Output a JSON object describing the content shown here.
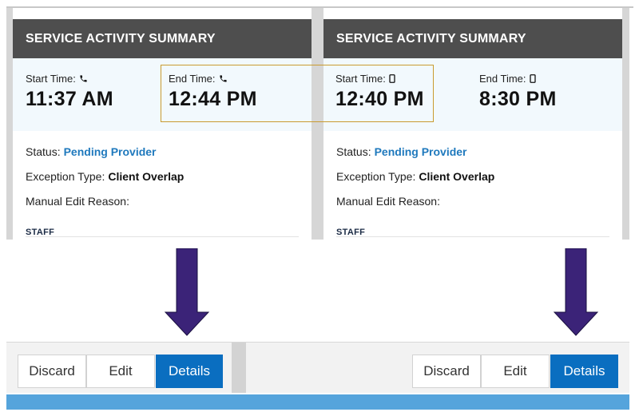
{
  "left_card": {
    "header": "SERVICE ACTIVITY SUMMARY",
    "start_label": "Start Time:",
    "start_icon": "phone-icon",
    "start_value": "11:37 AM",
    "end_label": "End Time:",
    "end_icon": "phone-icon",
    "end_value": "12:44 PM",
    "status_label": "Status:",
    "status_value": "Pending Provider",
    "exception_label": "Exception Type:",
    "exception_value": "Client Overlap",
    "manual_edit_label": "Manual Edit Reason:",
    "staff_label": "STAFF"
  },
  "right_card": {
    "header": "SERVICE ACTIVITY SUMMARY",
    "start_label": "Start Time:",
    "start_icon": "mobile-icon",
    "start_value": "12:40 PM",
    "end_label": "End Time:",
    "end_icon": "mobile-icon",
    "end_value": "8:30 PM",
    "status_label": "Status:",
    "status_value": "Pending Provider",
    "exception_label": "Exception Type:",
    "exception_value": "Client Overlap",
    "manual_edit_label": "Manual Edit Reason:",
    "staff_label": "STAFF"
  },
  "left_actions": {
    "discard": "Discard",
    "edit": "Edit",
    "details": "Details"
  },
  "right_actions": {
    "discard": "Discard",
    "edit": "Edit",
    "details": "Details"
  },
  "colors": {
    "header_bg": "#4e4e4e",
    "status_blue": "#1f79bd",
    "primary_button": "#0a6ec0",
    "arrow": "#3b2378",
    "highlight_border": "#c99b2f",
    "bottom_bar": "#55a4dc"
  }
}
